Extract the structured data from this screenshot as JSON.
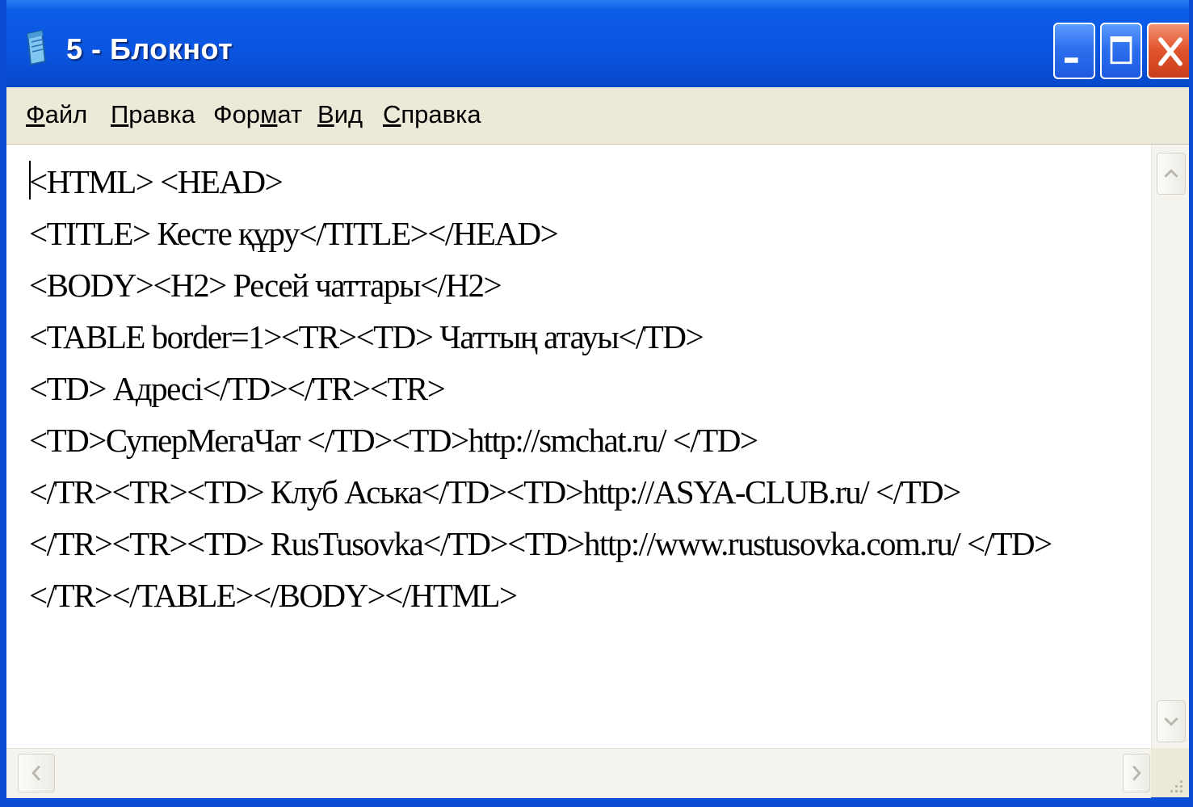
{
  "window": {
    "title": "5 - Блокнот"
  },
  "menu": {
    "items": [
      {
        "label_first": "Ф",
        "label_rest": "айл"
      },
      {
        "label_first": "П",
        "label_rest": "равка"
      },
      {
        "label_pre": "Фор",
        "label_u": "м",
        "label_post": "ат"
      },
      {
        "label_first": "В",
        "label_rest": "ид"
      },
      {
        "label_first": "С",
        "label_rest": "правка"
      }
    ]
  },
  "editor": {
    "lines": [
      "<HTML> <HEAD>",
      "<TITLE> Кесте құру</TITLE></HEAD>",
      "<BODY><H2> Ресей чаттары</H2>",
      "<TABLE border=1><TR><TD> Чаттың атауы</TD>",
      "<TD> Адресі</TD></TR><TR>",
      "<TD>СуперМегаЧат </TD><TD>http://smchat.ru/ </TD>",
      "</TR><TR><TD> Клуб Аська</TD><TD>http://ASYA-CLUB.ru/ </TD>",
      "</TR><TR><TD> RusTusovka</TD><TD>http://www.rustusovka.com.ru/ </TD>",
      "</TR></TABLE></BODY></HTML>"
    ]
  },
  "colors": {
    "titlebar": "#0a55e0",
    "menubar": "#ece9d8",
    "close_button": "#e2572f"
  },
  "icons": {
    "app": "notepad-icon",
    "minimize": "minimize-icon",
    "maximize": "maximize-icon",
    "close": "close-icon"
  }
}
